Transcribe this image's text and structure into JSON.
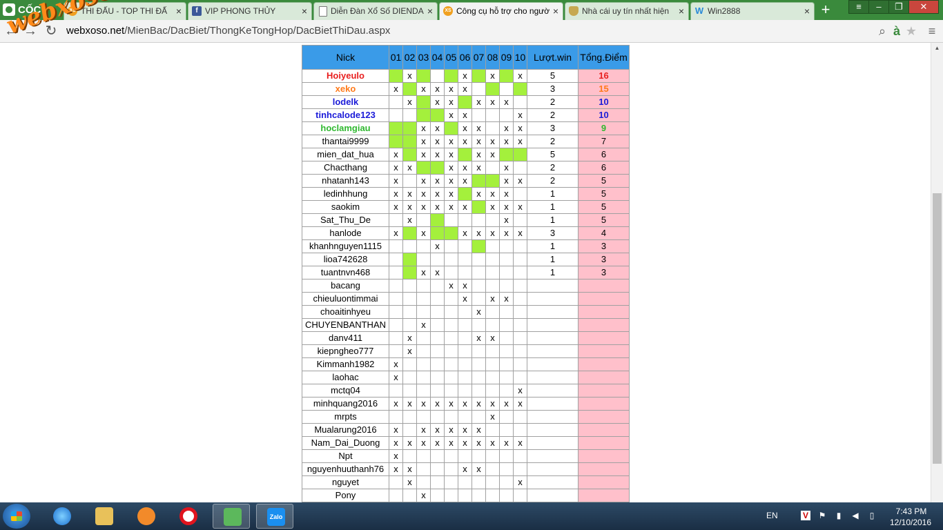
{
  "browser": {
    "logo": "CỐC CỐC",
    "tabs": [
      {
        "title": "THI ĐẤU - TOP THI ĐẤ",
        "icon": "xs-icon"
      },
      {
        "title": "VIP PHONG THỦY",
        "icon": "facebook-icon"
      },
      {
        "title": "Diễn Đàn Xổ Số DIENDA",
        "icon": "document-icon"
      },
      {
        "title": "Công cụ hỗ trợ cho ngườ",
        "icon": "xs-icon",
        "active": true
      },
      {
        "title": "Nhà cái uy tín nhất hiện",
        "icon": "shield-icon"
      },
      {
        "title": "Win2888",
        "icon": "w-icon"
      }
    ],
    "url_prefix": "webxoso.net",
    "url_path": "/MienBac/DacBiet/ThongKeTongHop/DacBietThiDau.aspx",
    "watermark": "webxoso.net"
  },
  "table": {
    "headers": {
      "nick": "Nick",
      "rounds": [
        "01",
        "02",
        "03",
        "04",
        "05",
        "06",
        "07",
        "08",
        "09",
        "10"
      ],
      "wins": "Lượt.win",
      "points": "Tổng.Điểm"
    },
    "rows": [
      {
        "nick": "Hoiyeulo",
        "style": "c1",
        "cells": "gxg.gxgxgx",
        "wins": "5",
        "points": "16"
      },
      {
        "nick": "xeko",
        "style": "c2",
        "cells": "xgxxxx.g.g",
        "wins": "3",
        "points": "15"
      },
      {
        "nick": "lodelk",
        "style": "c3",
        "cells": ".xgxxgxxx.",
        "wins": "2",
        "points": "10"
      },
      {
        "nick": "tinhcalode123",
        "style": "c3",
        "cells": "..ggxx...x",
        "wins": "2",
        "points": "10"
      },
      {
        "nick": "hoclamgiau",
        "style": "c4",
        "cells": "ggxxgxx.xx",
        "wins": "3",
        "points": "9"
      },
      {
        "nick": "thantai9999",
        "style": "",
        "cells": "ggxxxxxxxx",
        "wins": "2",
        "points": "7"
      },
      {
        "nick": "mien_dat_hua",
        "style": "",
        "cells": "xgxxxgxxgg",
        "wins": "5",
        "points": "6"
      },
      {
        "nick": "Chacthang",
        "style": "",
        "cells": "xxggxxx.x.",
        "wins": "2",
        "points": "6"
      },
      {
        "nick": "nhatanh143",
        "style": "",
        "cells": "x.xxxxggxx",
        "wins": "2",
        "points": "5"
      },
      {
        "nick": "ledinhhung",
        "style": "",
        "cells": "xxxxxgxxx.",
        "wins": "1",
        "points": "5"
      },
      {
        "nick": "saokim",
        "style": "",
        "cells": "xxxxxxgxxx",
        "wins": "1",
        "points": "5"
      },
      {
        "nick": "Sat_Thu_De",
        "style": "",
        "cells": ".x.g....x.",
        "wins": "1",
        "points": "5"
      },
      {
        "nick": "hanlode",
        "style": "",
        "cells": "xgxggxxxxx",
        "wins": "3",
        "points": "4"
      },
      {
        "nick": "khanhnguyen1115",
        "style": "",
        "cells": "...x..g...",
        "wins": "1",
        "points": "3"
      },
      {
        "nick": "lioa742628",
        "style": "",
        "cells": ".g........",
        "wins": "1",
        "points": "3"
      },
      {
        "nick": "tuantnvn468",
        "style": "",
        "cells": ".gxx......",
        "wins": "1",
        "points": "3"
      },
      {
        "nick": "bacang",
        "style": "",
        "cells": "....xx....",
        "wins": "",
        "points": ""
      },
      {
        "nick": "chieuluontimmai",
        "style": "",
        "cells": ".....x.xx.",
        "wins": "",
        "points": ""
      },
      {
        "nick": "choaitinhyeu",
        "style": "",
        "cells": "......x...",
        "wins": "",
        "points": ""
      },
      {
        "nick": "CHUYENBANTHAN",
        "style": "",
        "cells": "..x.......",
        "wins": "",
        "points": ""
      },
      {
        "nick": "danv411",
        "style": "",
        "cells": ".x....xx..",
        "wins": "",
        "points": ""
      },
      {
        "nick": "kiepngheo777",
        "style": "",
        "cells": ".x........",
        "wins": "",
        "points": ""
      },
      {
        "nick": "Kimmanh1982",
        "style": "",
        "cells": "x.........",
        "wins": "",
        "points": ""
      },
      {
        "nick": "laohac",
        "style": "",
        "cells": "x.........",
        "wins": "",
        "points": ""
      },
      {
        "nick": "mctq04",
        "style": "",
        "cells": ".........x",
        "wins": "",
        "points": ""
      },
      {
        "nick": "minhquang2016",
        "style": "",
        "cells": "xxxxxxxxxx",
        "wins": "",
        "points": ""
      },
      {
        "nick": "mrpts",
        "style": "",
        "cells": ".......x..",
        "wins": "",
        "points": ""
      },
      {
        "nick": "Mualarung2016",
        "style": "",
        "cells": "x.xxxxx...",
        "wins": "",
        "points": ""
      },
      {
        "nick": "Nam_Dai_Duong",
        "style": "",
        "cells": "xxxxxxxxxx",
        "wins": "",
        "points": ""
      },
      {
        "nick": "Npt",
        "style": "",
        "cells": "x.........",
        "wins": "",
        "points": ""
      },
      {
        "nick": "nguyenhuuthanh76",
        "style": "",
        "cells": "xx...xx...",
        "wins": "",
        "points": ""
      },
      {
        "nick": "nguyet",
        "style": "",
        "cells": ".x.......x",
        "wins": "",
        "points": ""
      },
      {
        "nick": "Pony",
        "style": "",
        "cells": "..x.......",
        "wins": "",
        "points": ""
      }
    ]
  },
  "colors": {
    "header_bg": "#3a9be8",
    "hit": "#a4f03c",
    "points_bg": "#ffc0cb",
    "rank1": "#e81e1e",
    "rank2": "#ff7a1a",
    "rank3": "#1a1ad8",
    "rank4": "#2fb82f"
  },
  "taskbar": {
    "apps": [
      "internet-explorer-icon",
      "file-explorer-icon",
      "media-player-icon",
      "opera-icon",
      "coccoc-icon",
      "zalo-icon"
    ],
    "zalo_label": "Zalo",
    "lang": "EN",
    "time": "7:43 PM",
    "date": "12/10/2016"
  }
}
